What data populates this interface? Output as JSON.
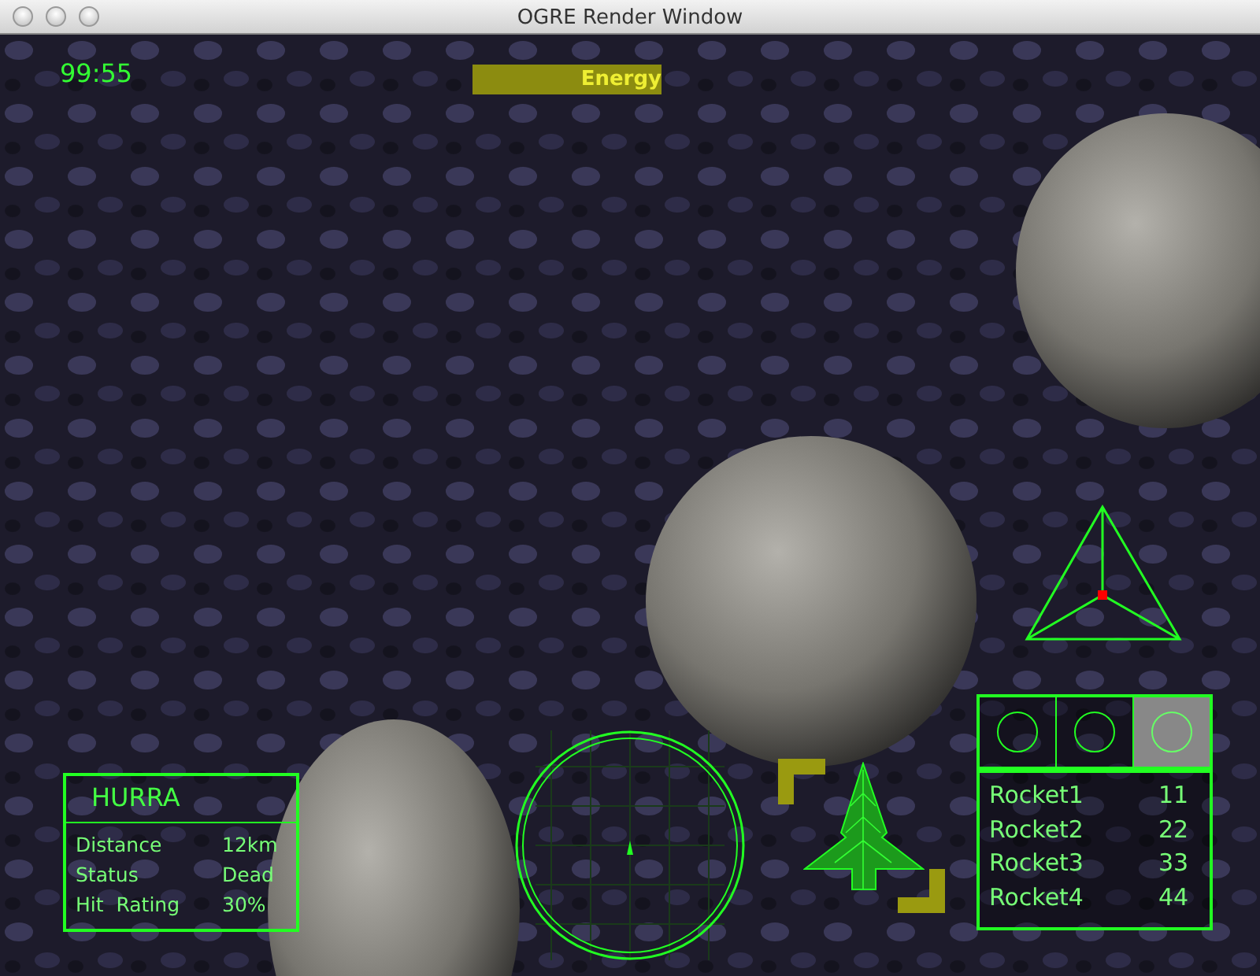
{
  "window": {
    "title": "OGRE Render Window"
  },
  "hud": {
    "timer": "99:55",
    "energy": {
      "label": "Energy"
    },
    "target": {
      "name": "HURRA",
      "rows": [
        {
          "label": "Distance",
          "value": "12km"
        },
        {
          "label": "Status",
          "value": "Dead"
        },
        {
          "label": "Hit  Rating",
          "value": "30%"
        }
      ]
    },
    "weapon_slots": [
      {
        "selected": false
      },
      {
        "selected": false
      },
      {
        "selected": true
      }
    ],
    "rockets": [
      {
        "name": "Rocket1",
        "count": "11"
      },
      {
        "name": "Rocket2",
        "count": "22"
      },
      {
        "name": "Rocket3",
        "count": "33"
      },
      {
        "name": "Rocket4",
        "count": "44"
      }
    ]
  }
}
